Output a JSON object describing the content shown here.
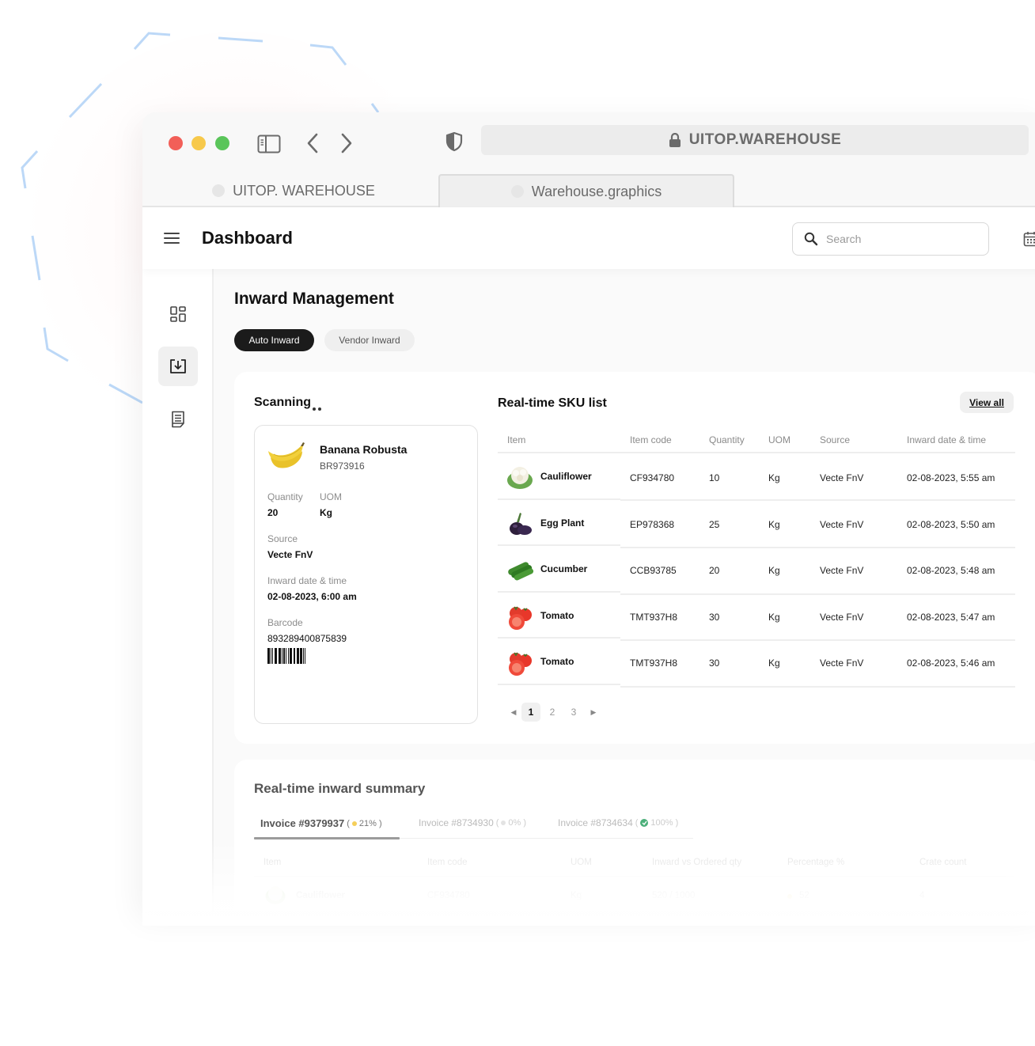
{
  "browser": {
    "url": "UITOP.WAREHOUSE",
    "tabs": [
      {
        "label": "UITOP. WAREHOUSE",
        "active": false
      },
      {
        "label": "Warehouse.graphics",
        "active": true
      }
    ]
  },
  "header": {
    "title": "Dashboard",
    "search_placeholder": "Search"
  },
  "sidebar": {
    "items": [
      {
        "icon": "grid-icon",
        "name": "dashboard",
        "active": false
      },
      {
        "icon": "inbox-download-icon",
        "name": "inward",
        "active": true
      },
      {
        "icon": "report-icon",
        "name": "reports",
        "active": false
      }
    ]
  },
  "main": {
    "title": "Inward Management",
    "mode_tabs": [
      {
        "label": "Auto Inward",
        "active": true
      },
      {
        "label": "Vendor Inward",
        "active": false
      }
    ],
    "scanning": {
      "title": "Scanning",
      "item": {
        "name": "Banana Robusta",
        "code": "BR973916",
        "image": "banana",
        "quantity_label": "Quantity",
        "quantity": "20",
        "uom_label": "UOM",
        "uom": "Kg",
        "source_label": "Source",
        "source": "Vecte FnV",
        "datetime_label": "Inward date & time",
        "datetime": "02-08-2023, 6:00 am",
        "barcode_label": "Barcode",
        "barcode": "893289400875839"
      }
    },
    "sku_list": {
      "title": "Real-time SKU list",
      "view_all": "View all",
      "columns": [
        "Item",
        "Item code",
        "Quantity",
        "UOM",
        "Source",
        "Inward date & time"
      ],
      "rows": [
        {
          "image": "cauliflower",
          "item": "Cauliflower",
          "code": "CF934780",
          "qty": "10",
          "uom": "Kg",
          "source": "Vecte FnV",
          "datetime": "02-08-2023, 5:55 am"
        },
        {
          "image": "eggplant",
          "item": "Egg Plant",
          "code": "EP978368",
          "qty": "25",
          "uom": "Kg",
          "source": "Vecte FnV",
          "datetime": "02-08-2023, 5:50 am"
        },
        {
          "image": "cucumber",
          "item": "Cucumber",
          "code": "CCB93785",
          "qty": "20",
          "uom": "Kg",
          "source": "Vecte FnV",
          "datetime": "02-08-2023, 5:48 am"
        },
        {
          "image": "tomato",
          "item": "Tomato",
          "code": "TMT937H8",
          "qty": "30",
          "uom": "Kg",
          "source": "Vecte FnV",
          "datetime": "02-08-2023, 5:47 am"
        },
        {
          "image": "tomato",
          "item": "Tomato",
          "code": "TMT937H8",
          "qty": "30",
          "uom": "Kg",
          "source": "Vecte FnV",
          "datetime": "02-08-2023, 5:46 am"
        }
      ],
      "pagination": {
        "pages": [
          "1",
          "2",
          "3"
        ],
        "current": "1"
      }
    },
    "summary": {
      "title": "Real-time inward summary",
      "invoices": [
        {
          "label": "Invoice #9379937",
          "percent": "21%",
          "status": "in-progress",
          "color": "#f5cf5a",
          "active": true
        },
        {
          "label": "Invoice #8734930",
          "percent": "0%",
          "status": "pending",
          "color": "#dddddd",
          "active": false
        },
        {
          "label": "Invoice #8734634",
          "percent": "100%",
          "status": "complete",
          "color": "#4caf7a",
          "active": false
        }
      ],
      "columns": [
        "Item",
        "Item code",
        "UOM",
        "Inward vs Ordered qty",
        "Percentage %",
        "Crate count"
      ],
      "rows": [
        {
          "image": "cauliflower",
          "item": "Cauliflower",
          "code": "CF934780",
          "uom": "Kg",
          "inward_vs_ordered": "520 / 1000",
          "percentage": "52",
          "crate_count": "4"
        }
      ]
    }
  },
  "colors": {
    "accent_dark": "#1b1b1b",
    "traffic_red": "#f25f58",
    "traffic_yellow": "#f7c94b",
    "traffic_green": "#5ac55a",
    "deco_blue": "#bcd8f7"
  }
}
